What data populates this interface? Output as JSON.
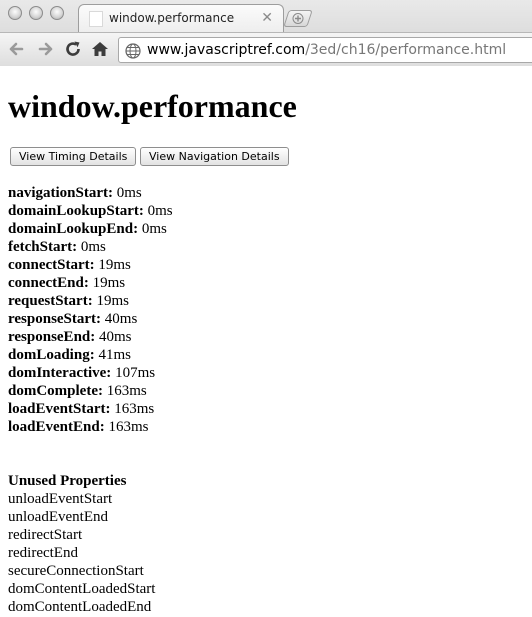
{
  "browser": {
    "tab_title": "window.performance",
    "url_host": "www.javascriptref.com",
    "url_path": "/3ed/ch16/performance.html"
  },
  "page": {
    "title": "window.performance",
    "buttons": {
      "timing": "View Timing Details",
      "navigation": "View Navigation Details"
    },
    "timing": [
      {
        "key": "navigationStart:",
        "value": "0ms"
      },
      {
        "key": "domainLookupStart:",
        "value": "0ms"
      },
      {
        "key": "domainLookupEnd:",
        "value": "0ms"
      },
      {
        "key": "fetchStart:",
        "value": "0ms"
      },
      {
        "key": "connectStart:",
        "value": "19ms"
      },
      {
        "key": "connectEnd:",
        "value": "19ms"
      },
      {
        "key": "requestStart:",
        "value": "19ms"
      },
      {
        "key": "responseStart:",
        "value": "40ms"
      },
      {
        "key": "responseEnd:",
        "value": "40ms"
      },
      {
        "key": "domLoading:",
        "value": "41ms"
      },
      {
        "key": "domInteractive:",
        "value": "107ms"
      },
      {
        "key": "domComplete:",
        "value": "163ms"
      },
      {
        "key": "loadEventStart:",
        "value": "163ms"
      },
      {
        "key": "loadEventEnd:",
        "value": "163ms"
      }
    ],
    "unused": {
      "heading": "Unused Properties",
      "items": [
        "unloadEventStart",
        "unloadEventEnd",
        "redirectStart",
        "redirectEnd",
        "secureConnectionStart",
        "domContentLoadedStart",
        "domContentLoadedEnd"
      ]
    }
  }
}
